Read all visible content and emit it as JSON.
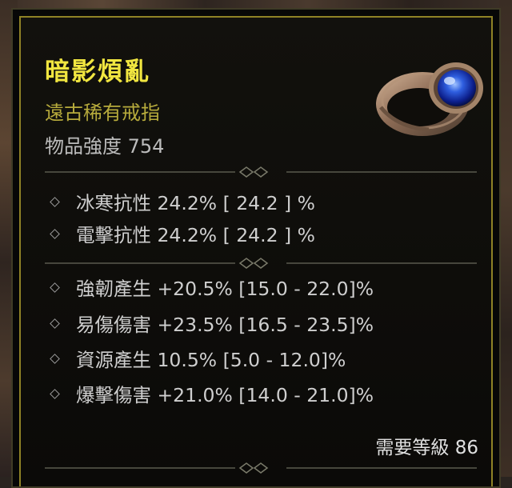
{
  "item": {
    "name": "暗影煩亂",
    "type": "遠古稀有戒指",
    "power_label": "物品強度 754",
    "colors": {
      "name": "#f1e640",
      "type": "#b7ab3c",
      "frame": "#8f8226"
    }
  },
  "implicit_stats": [
    {
      "text": "冰寒抗性 24.2%   [ 24.2 ] %"
    },
    {
      "text": "電擊抗性 24.2%   [ 24.2 ] %"
    }
  ],
  "affix_stats": [
    {
      "text": "強韌產生 +20.5% [15.0 - 22.0]%"
    },
    {
      "text": "易傷傷害 +23.5% [16.5 - 23.5]%"
    },
    {
      "text": "資源產生 10.5% [5.0 - 12.0]%"
    },
    {
      "text": "爆擊傷害 +21.0% [14.0 - 21.0]%"
    }
  ],
  "requirement": {
    "level_label": "需要等級 86"
  },
  "icons": {
    "item": "ring-icon",
    "bullet": "diamond-bullet-icon",
    "divider": "ornate-divider"
  }
}
